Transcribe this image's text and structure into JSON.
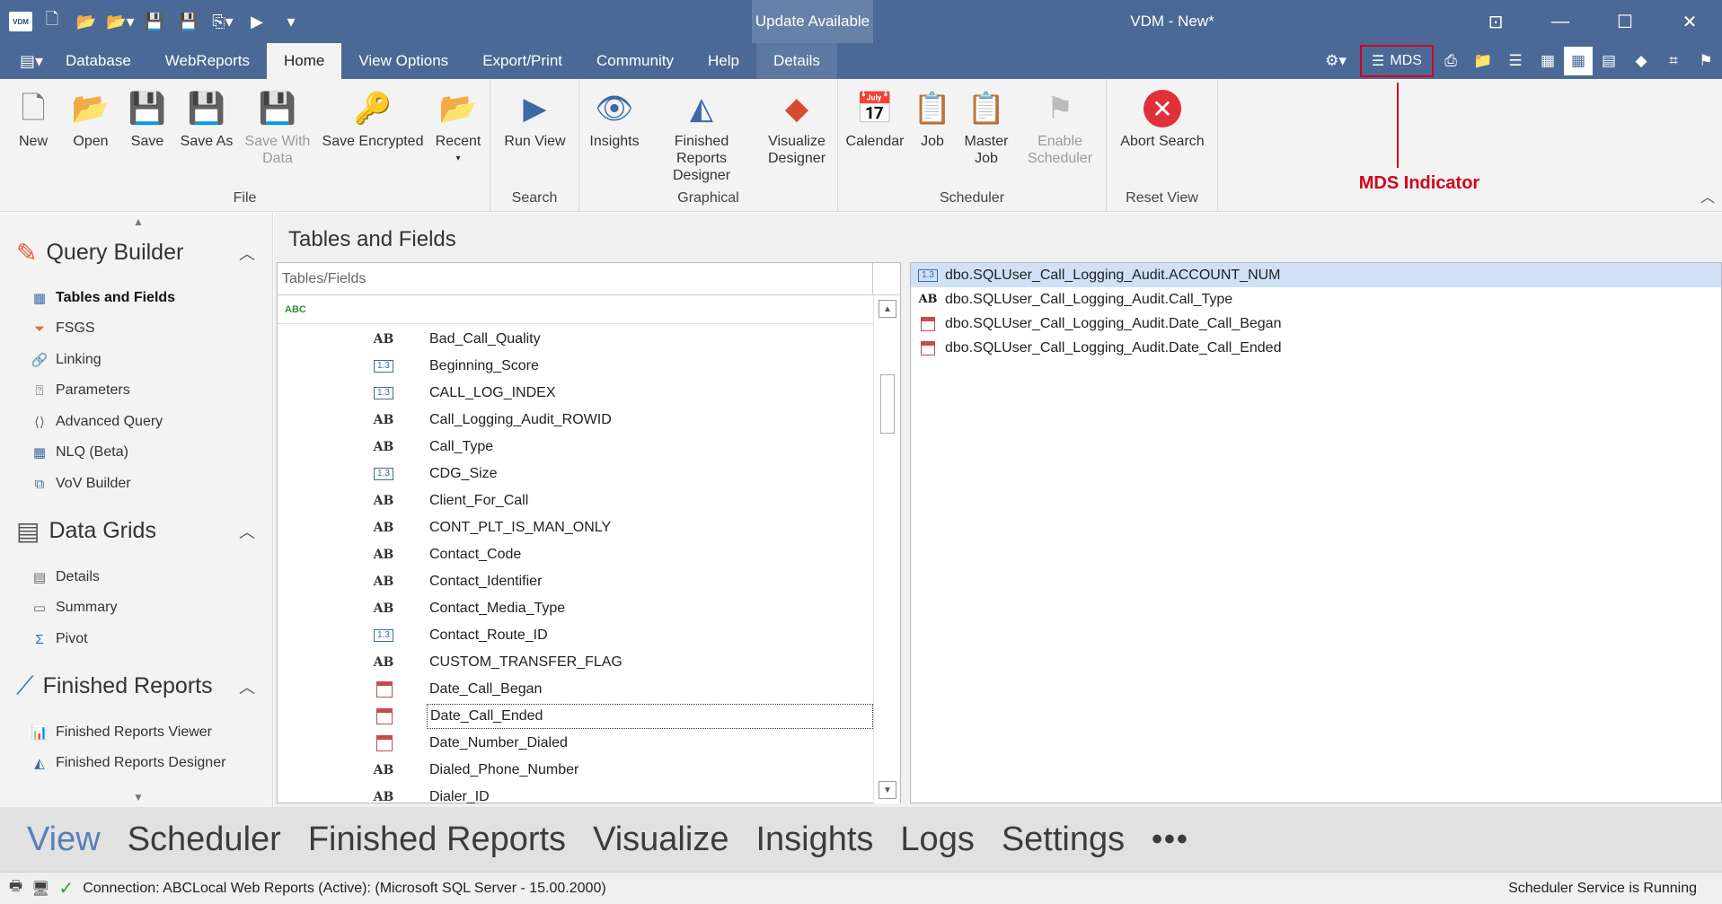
{
  "titlebar": {
    "logo": "VDM",
    "update": "Update Available",
    "title": "VDM - New*"
  },
  "menu": {
    "tabs": [
      "Database",
      "WebReports",
      "Home",
      "View Options",
      "Export/Print",
      "Community",
      "Help",
      "Details"
    ],
    "active": "Home",
    "mds": "MDS"
  },
  "ribbon": {
    "file": {
      "label": "File",
      "buttons": [
        "New",
        "Open",
        "Save",
        "Save As",
        "Save With Data",
        "Save Encrypted",
        "Recent"
      ]
    },
    "search": {
      "label": "Search",
      "buttons": [
        "Run View"
      ]
    },
    "graphical": {
      "label": "Graphical",
      "buttons": [
        "Insights",
        "Finished Reports Designer",
        "Visualize Designer"
      ]
    },
    "scheduler": {
      "label": "Scheduler",
      "buttons": [
        "Calendar",
        "Job",
        "Master Job",
        "Enable Scheduler"
      ]
    },
    "reset": {
      "label": "Reset View",
      "buttons": [
        "Abort Search"
      ]
    }
  },
  "annotation": {
    "label": "MDS Indicator",
    "color": "#d0021b"
  },
  "leftnav": {
    "query_builder": {
      "title": "Query Builder",
      "items": [
        "Tables and Fields",
        "FSGS",
        "Linking",
        "Parameters",
        "Advanced Query",
        "NLQ (Beta)",
        "VoV Builder"
      ]
    },
    "data_grids": {
      "title": "Data Grids",
      "items": [
        "Details",
        "Summary",
        "Pivot"
      ]
    },
    "finished_reports": {
      "title": "Finished Reports",
      "items": [
        "Finished Reports Viewer",
        "Finished Reports Designer"
      ]
    }
  },
  "content": {
    "title": "Tables and Fields",
    "column_header": "Tables/Fields",
    "filter_icon": "ABC",
    "fields": [
      {
        "type": "AB",
        "name": "Bad_Call_Quality"
      },
      {
        "type": "1.3",
        "name": "Beginning_Score"
      },
      {
        "type": "1.3",
        "name": "CALL_LOG_INDEX"
      },
      {
        "type": "AB",
        "name": "Call_Logging_Audit_ROWID"
      },
      {
        "type": "AB",
        "name": "Call_Type"
      },
      {
        "type": "1.3",
        "name": "CDG_Size"
      },
      {
        "type": "AB",
        "name": "Client_For_Call"
      },
      {
        "type": "AB",
        "name": "CONT_PLT_IS_MAN_ONLY"
      },
      {
        "type": "AB",
        "name": "Contact_Code"
      },
      {
        "type": "AB",
        "name": "Contact_Identifier"
      },
      {
        "type": "AB",
        "name": "Contact_Media_Type"
      },
      {
        "type": "1.3",
        "name": "Contact_Route_ID"
      },
      {
        "type": "AB",
        "name": "CUSTOM_TRANSFER_FLAG"
      },
      {
        "type": "date",
        "name": "Date_Call_Began"
      },
      {
        "type": "date",
        "name": "Date_Call_Ended"
      },
      {
        "type": "date",
        "name": "Date_Number_Dialed"
      },
      {
        "type": "AB",
        "name": "Dialed_Phone_Number"
      },
      {
        "type": "AB",
        "name": "Dialer_ID"
      }
    ],
    "selected": [
      {
        "type": "1.3",
        "name": "dbo.SQLUser_Call_Logging_Audit.ACCOUNT_NUM"
      },
      {
        "type": "AB",
        "name": "dbo.SQLUser_Call_Logging_Audit.Call_Type"
      },
      {
        "type": "date",
        "name": "dbo.SQLUser_Call_Logging_Audit.Date_Call_Began"
      },
      {
        "type": "date",
        "name": "dbo.SQLUser_Call_Logging_Audit.Date_Call_Ended"
      }
    ]
  },
  "bottomnav": [
    "View",
    "Scheduler",
    "Finished Reports",
    "Visualize",
    "Insights",
    "Logs",
    "Settings",
    "•••"
  ],
  "status": {
    "connection": "Connection: ABCLocal Web Reports (Active): (Microsoft SQL Server - 15.00.2000)",
    "scheduler": "Scheduler Service is Running"
  }
}
